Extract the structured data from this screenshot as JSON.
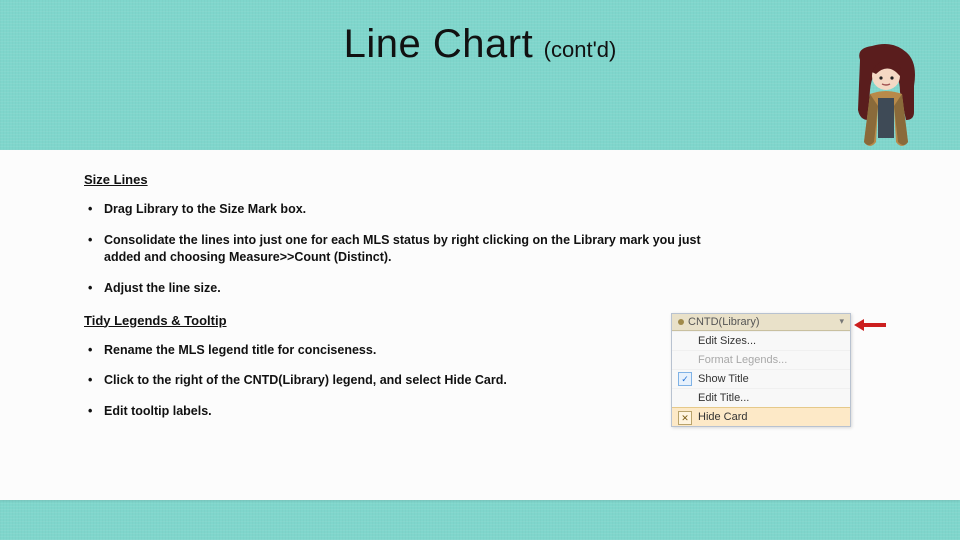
{
  "title": {
    "main": "Line Chart",
    "suffix": "(cont'd)"
  },
  "section1": {
    "heading": "Size Lines",
    "items": [
      "Drag Library to the Size Mark box.",
      "Consolidate the lines into just one for each MLS status by right clicking on the Library mark you just added and choosing Measure>>Count (Distinct).",
      "Adjust the line size."
    ]
  },
  "section2": {
    "heading": "Tidy Legends & Tooltip",
    "items": [
      "Rename the MLS legend title for conciseness.",
      "Click to the right of the CNTD(Library) legend, and select Hide Card.",
      "Edit tooltip labels."
    ]
  },
  "menu": {
    "header": "CNTD(Library)",
    "items": [
      {
        "label": "Edit Sizes...",
        "state": "normal"
      },
      {
        "label": "Format Legends...",
        "state": "disabled"
      },
      {
        "label": "Show Title",
        "state": "checked"
      },
      {
        "label": "Edit Title...",
        "state": "normal"
      },
      {
        "label": "Hide Card",
        "state": "hide"
      }
    ]
  }
}
